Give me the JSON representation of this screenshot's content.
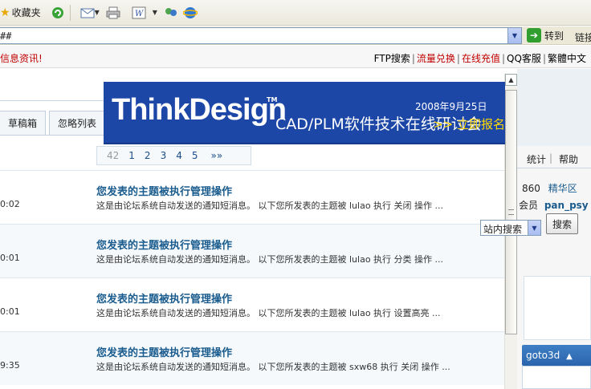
{
  "browser": {
    "favorites_label": "收藏夹",
    "icons": [
      "star-icon",
      "refresh-icon",
      "mail-icon",
      "print-icon",
      "word-icon",
      "messenger-icon",
      "ie-icon"
    ],
    "address": {
      "value": "##",
      "go_label": "转到",
      "links_label": "链接"
    }
  },
  "site": {
    "news": "信息资讯!",
    "top_links": [
      "FTP搜索",
      "流量兑换",
      "在线充值",
      "QQ客服",
      "繁體中文"
    ],
    "top_link_colors": [
      "#000000",
      "#c00000",
      "#c00000",
      "#000000",
      "#000000"
    ],
    "search_scope": "站内搜索",
    "search_button": "搜索"
  },
  "forum": {
    "tabs": [
      "草稿箱",
      "忽略列表"
    ],
    "pager": {
      "current": "42",
      "pages": [
        "1",
        "2",
        "3",
        "4",
        "5"
      ],
      "next": "»»"
    },
    "rows": [
      {
        "time": "0:02",
        "title": "您发表的主题被执行管理操作",
        "desc": "这是由论坛系统自动发送的通知短消息。  以下您所发表的主题被  lulao 执行  关闭  操作  ..."
      },
      {
        "time": "0:01",
        "title": "您发表的主题被执行管理操作",
        "desc": "这是由论坛系统自动发送的通知短消息。  以下您所发表的主题被  lulao 执行  分类  操作  ..."
      },
      {
        "time": "0:01",
        "title": "您发表的主题被执行管理操作",
        "desc": "这是由论坛系统自动发送的通知短消息。  以下您所发表的主题被  lulao 执行  设置高亮  ..."
      },
      {
        "time": "9:35",
        "title": "您发表的主题被执行管理操作",
        "desc": "这是由论坛系统自动发送的通知短消息。  以下您所发表的主题被  sxw68 执行  关闭  操作  ..."
      }
    ]
  },
  "banner": {
    "brand": "ThinkDesign",
    "tm": "TM",
    "date": "2008年9月25日",
    "subject": "CAD/PLM软件技术在线研讨会",
    "cta": ">> 立即报名",
    "bg_color": "#1d47a7"
  },
  "sidebar": {
    "nav": [
      "统计",
      "帮助"
    ],
    "stat_number": "860",
    "stat_link": "精华区",
    "member_prefix": "会员",
    "member_name": "pan_psy",
    "goto_label": "goto3d"
  }
}
